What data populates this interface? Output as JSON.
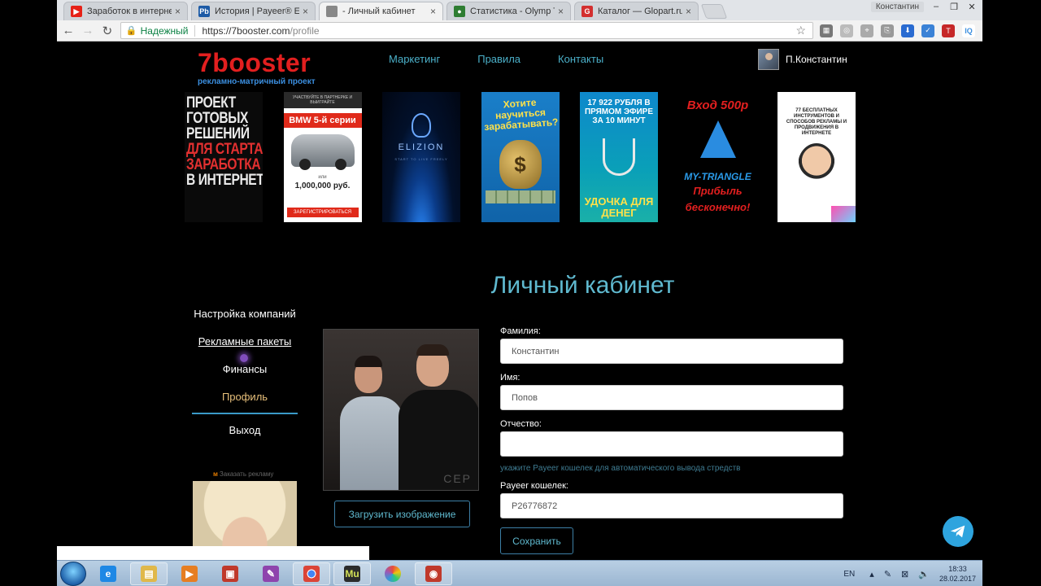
{
  "browser": {
    "tabs": [
      {
        "title": "Заработок в интернете",
        "favicon": "youtube-icon",
        "color": "#e62117",
        "glyph": "▶",
        "active": false
      },
      {
        "title": "История | Payeer® E-W",
        "favicon": "payeer-icon",
        "color": "#1c5aa6",
        "glyph": "Pb",
        "active": false
      },
      {
        "title": "- Личный кабинет",
        "favicon": "page-icon",
        "color": "#888888",
        "glyph": "",
        "active": true
      },
      {
        "title": "Статистика - Olymp Trade",
        "favicon": "olymp-icon",
        "color": "#2e7d32",
        "glyph": "●",
        "active": false
      },
      {
        "title": "Каталог — Glopart.ru",
        "favicon": "glopart-icon",
        "color": "#d32f2f",
        "glyph": "G",
        "active": false
      }
    ],
    "profile_chip": "Константин",
    "secure_label": "Надежный",
    "url_host": "https://7booster.com",
    "url_path": "/profile"
  },
  "site": {
    "logo": "7booster",
    "logo_subtitle": "рекламно-матричный проект",
    "nav": [
      "Маркетинг",
      "Правила",
      "Контакты"
    ],
    "user_name": "П.Константин",
    "banners": {
      "b1_lines": [
        "ПРОЕКТ",
        "ГОТОВЫХ",
        "РЕШЕНИЙ",
        "ДЛЯ СТАРТА",
        "ЗАРАБОТКА",
        "В ИНТЕРНЕТ"
      ],
      "b2_top": "УЧАСТВУЙТЕ В ПАРТНЕРКЕ И ВЫИГРАЙТЕ",
      "b2_title": "BMW 5-й серии",
      "b2_or": "или",
      "b2_amount": "1,000,000 руб.",
      "b2_button": "ЗАРЕГИСТРИРОВАТЬСЯ",
      "b3_name": "ELIZION",
      "b3_tag": "START TO LIVE FREELY",
      "b4_text": "Хотите научиться зарабатывать?",
      "b5_text": "17 922 РУБЛЯ В ПРЯМОМ ЭФИРЕ ЗА 10 МИНУТ",
      "b5_bottom": "УДОЧКА ДЛЯ ДЕНЕГ",
      "b6_top": "Вход 500р",
      "b6_brand": "MY-TRIANGLE",
      "b6_line1": "Прибыль",
      "b6_line2": "бесконечно!",
      "b7_text": "77 БЕСПЛАТНЫХ ИНСТРУМЕНТОВ И СПОСОБОВ РЕКЛАМЫ И ПРОДВИЖЕНИЯ В ИНТЕРНЕТЕ"
    },
    "page_title": "Личный кабинет",
    "side_menu": [
      {
        "label": "Настройка компаний",
        "state": "normal"
      },
      {
        "label": "Рекламные пакеты",
        "state": "link"
      },
      {
        "label": "Финансы",
        "state": "normal"
      },
      {
        "label": "Профиль",
        "state": "active"
      },
      {
        "label": "Выход",
        "state": "normal"
      }
    ],
    "ad_label": "Заказать рекламу",
    "photo_watermark": "СЕР",
    "upload_button": "Загрузить изображение",
    "form": {
      "surname_label": "Фамилия:",
      "surname_value": "Константин",
      "name_label": "Имя:",
      "name_value": "Попов",
      "patronymic_label": "Отчество:",
      "patronymic_value": "",
      "payeer_hint": "укажите Payeer кошелек для автоматического вывода стредств",
      "payeer_label": "Payeer кошелек:",
      "payeer_value": "P26776872",
      "save_button": "Сохранить"
    }
  },
  "taskbar": {
    "language": "EN",
    "time": "18:33",
    "date": "28.02.2017"
  }
}
